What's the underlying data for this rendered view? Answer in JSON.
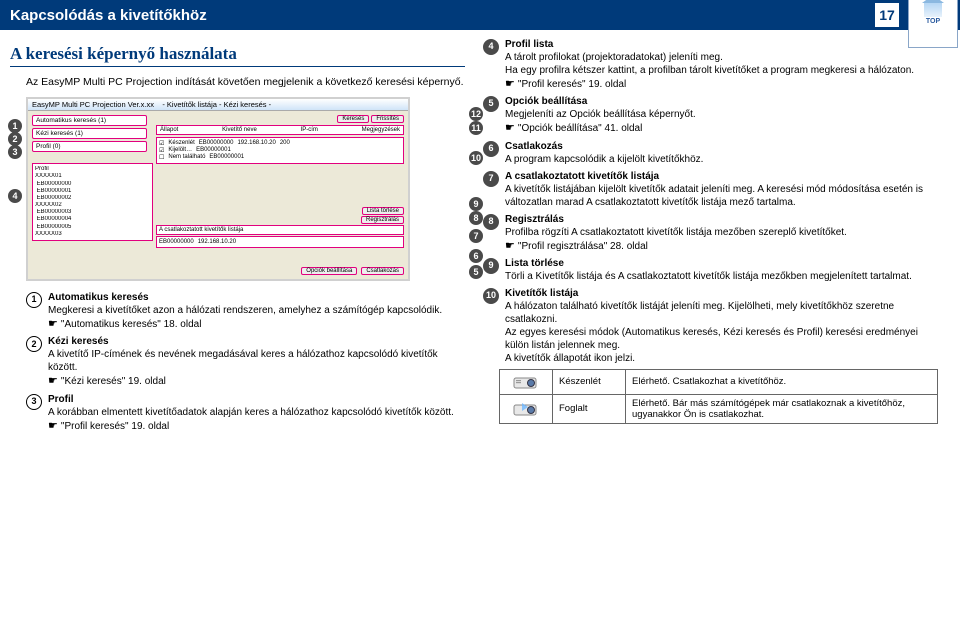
{
  "header": {
    "title": "Kapcsolódás a kivetítőkhöz",
    "page_number": "17",
    "logo_text": "TOP"
  },
  "section_title": "A keresési képernyő használata",
  "intro": "Az EasyMP Multi PC Projection indítását követően megjelenik a következő keresési képernyő.",
  "screenshot": {
    "window_title": "EasyMP Multi PC Projection Ver.x.xx",
    "panel_title": "- Kivetítők listája - Kézi keresés -",
    "tab_auto": "Automatikus keresés",
    "tab_auto_count": "(1)",
    "tab_manual": "Kézi keresés",
    "tab_manual_count": "(1)",
    "tab_profile": "Profil",
    "tab_profile_count": "(0)",
    "tree_root": "Profil",
    "tree_items": [
      "XXXXX01",
      "EB00000000",
      "EB00000001",
      "EB00000002",
      "XXXXX02",
      "EB00000003",
      "EB00000004",
      "EB00000005",
      "XXXXX03"
    ],
    "col_status": "Állapot",
    "col_name": "Kivetítő neve",
    "col_ip": "IP-cím",
    "col_note": "Megjegyzések",
    "btn_search": "Keresés",
    "btn_refresh": "Frissítés",
    "row1_status": "Készenlét",
    "row1_name": "EB00000000",
    "row1_ip": "192.168.10.20",
    "row1_note": "200",
    "row2_status": "Kijelölt…",
    "row2_name": "EB00000001",
    "row3_status": "Nem található",
    "row3_name": "EB00000001",
    "lower_title": "A csatlakoztatott kivetítők listája",
    "btn_list": "Lista törlése",
    "btn_reg": "Regisztrálás",
    "lower_name": "EB00000000",
    "lower_ip": "192.168.10.20",
    "btn_options": "Opciók beállítása",
    "btn_connect": "Csatlakozás"
  },
  "defs_left": [
    {
      "n": "1",
      "title": "Automatikus keresés",
      "body": "Megkeresi a kivetítőket azon a hálózati rendszeren, amelyhez a számítógép kapcsolódik.",
      "ref": "\"Automatikus keresés\" 18. oldal"
    },
    {
      "n": "2",
      "title": "Kézi keresés",
      "body": "A kivetítő IP-címének és nevének megadásával keres a hálózathoz kapcsolódó kivetítők között.",
      "ref": "\"Kézi keresés\" 19. oldal"
    },
    {
      "n": "3",
      "title": "Profil",
      "body": "A korábban elmentett kivetítőadatok alapján keres a hálózathoz kapcsolódó kivetítők között.",
      "ref": "\"Profil keresés\" 19. oldal"
    }
  ],
  "defs_right": [
    {
      "n": "4",
      "title": "Profil lista",
      "body": "A tárolt profilokat (projektoradatokat) jeleníti meg.\nHa egy profilra kétszer kattint, a profilban tárolt kivetítőket a program megkeresi a hálózaton.",
      "ref": "\"Profil keresés\" 19. oldal"
    },
    {
      "n": "5",
      "title": "Opciók beállítása",
      "body": "Megjeleníti az Opciók beállítása képernyőt.",
      "ref": "\"Opciók beállítása\" 41. oldal"
    },
    {
      "n": "6",
      "title": "Csatlakozás",
      "body": "A program kapcsolódik a kijelölt kivetítőkhöz."
    },
    {
      "n": "7",
      "title": "A csatlakoztatott kivetítők listája",
      "body": "A kivetítők listájában kijelölt kivetítők adatait jeleníti meg. A keresési mód módosítása esetén is változatlan marad A csatlakoztatott kivetítők listája mező tartalma."
    },
    {
      "n": "8",
      "title": "Regisztrálás",
      "body": "Profilba rögzíti A csatlakoztatott kivetítők listája mezőben szereplő kivetítőket.",
      "ref": "\"Profil regisztrálása\" 28. oldal"
    },
    {
      "n": "9",
      "title": "Lista törlése",
      "body": "Törli a Kivetítők listája és A csatlakoztatott kivetítők listája mezőkben megjelenített tartalmat."
    },
    {
      "n": "10",
      "title": "Kivetítők listája",
      "body": "A hálózaton található kivetítők listáját jeleníti meg. Kijelölheti, mely kivetítőkhöz szeretne csatlakozni.\nAz egyes keresési módok (Automatikus keresés, Kézi keresés és Profil) keresési eredményei külön listán jelennek meg.\nA kivetítők állapotát ikon jelzi."
    }
  ],
  "status_table": {
    "standby_label": "Készenlét",
    "standby_desc": "Elérhető. Csatlakozhat a kivetítőhöz.",
    "busy_label": "Foglalt",
    "busy_desc": "Elérhető. Bár más számítógépek már csatlakoznak a kivetítőhöz, ugyanakkor Ön is csatlakozhat."
  }
}
